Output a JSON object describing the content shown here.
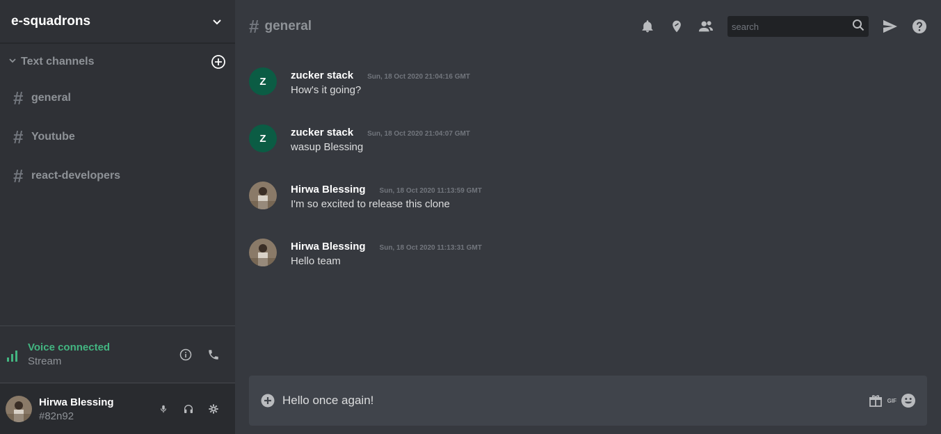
{
  "server": {
    "name": "e-squadrons"
  },
  "channels_section": {
    "title": "Text channels"
  },
  "channels": [
    {
      "hash": "#",
      "name": "general"
    },
    {
      "hash": "#",
      "name": "Youtube"
    },
    {
      "hash": "#",
      "name": "react-developers"
    }
  ],
  "voice": {
    "status": "Voice connected",
    "stream": "Stream"
  },
  "user": {
    "name": "Hirwa Blessing",
    "tag": "#82n92"
  },
  "header": {
    "hash": "#",
    "channel": "general",
    "search_placeholder": "search"
  },
  "messages": [
    {
      "initial": "Z",
      "author": "zucker stack",
      "time": "Sun, 18 Oct 2020 21:04:16 GMT",
      "text": "How's it going?"
    },
    {
      "initial": "Z",
      "author": "zucker stack",
      "time": "Sun, 18 Oct 2020 21:04:07 GMT",
      "text": "wasup Blessing"
    },
    {
      "initial": "",
      "author": "Hirwa Blessing",
      "time": "Sun, 18 Oct 2020 11:13:59 GMT",
      "text": "I'm so excited to release this clone"
    },
    {
      "initial": "",
      "author": "Hirwa Blessing",
      "time": "Sun, 18 Oct 2020 11:13:31 GMT",
      "text": "Hello team"
    }
  ],
  "composer": {
    "value": "Hello once again!",
    "gif_label": "GIF"
  },
  "colors": {
    "accent_green": "#43b581",
    "bg_main": "#36393f",
    "bg_sidebar": "#2f3136",
    "avatar_green": "#0b5c44"
  }
}
